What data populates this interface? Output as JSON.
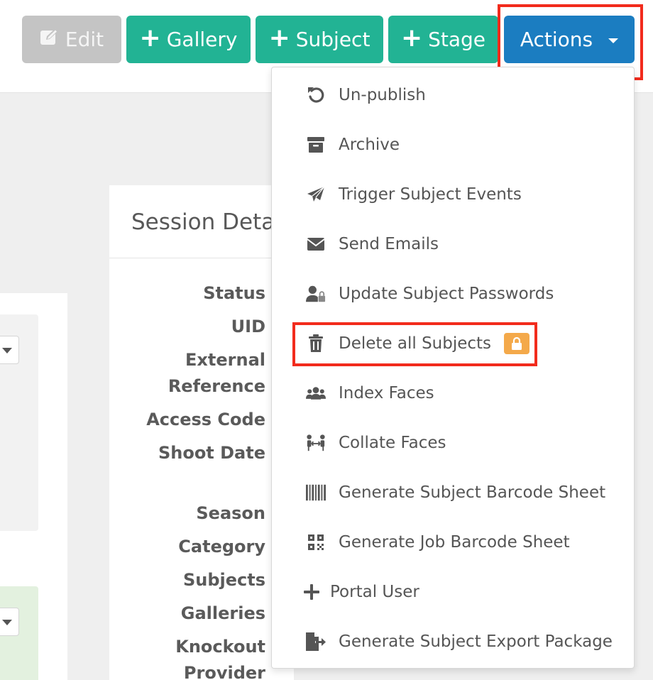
{
  "toolbar": {
    "edit_label": "Edit",
    "gallery_label": "Gallery",
    "subject_label": "Subject",
    "stage_label": "Stage",
    "actions_label": "Actions"
  },
  "panel": {
    "title": "Session Detai",
    "fields": {
      "status": "Status",
      "uid": "UID",
      "external_reference_line1": "External",
      "external_reference_line2": "Reference",
      "access_code": "Access Code",
      "shoot_date": "Shoot Date",
      "season": "Season",
      "category": "Category",
      "subjects": "Subjects",
      "galleries": "Galleries",
      "knockout_provider_line1": "Knockout",
      "knockout_provider_line2": "Provider"
    }
  },
  "actions_menu": {
    "items": [
      {
        "label": "Un-publish",
        "icon": "undo-icon"
      },
      {
        "label": "Archive",
        "icon": "archive-icon"
      },
      {
        "label": "Trigger Subject Events",
        "icon": "paper-plane-icon"
      },
      {
        "label": "Send Emails",
        "icon": "envelope-icon"
      },
      {
        "label": "Update Subject Passwords",
        "icon": "user-lock-icon"
      },
      {
        "label": "Delete all Subjects",
        "icon": "trash-icon",
        "locked": true
      },
      {
        "label": "Index Faces",
        "icon": "users-icon"
      },
      {
        "label": "Collate Faces",
        "icon": "people-arrows-icon"
      },
      {
        "label": "Generate Subject Barcode Sheet",
        "icon": "barcode-icon"
      },
      {
        "label": "Generate Job Barcode Sheet",
        "icon": "qrcode-icon"
      },
      {
        "label": "Portal User",
        "icon": "plus-icon"
      },
      {
        "label": "Generate Subject Export Package",
        "icon": "file-export-icon"
      }
    ]
  },
  "colors": {
    "green": "#22b394",
    "blue": "#1b7dc1",
    "disabled": "#c4c4c4",
    "highlight": "#f22b1c",
    "lock_badge": "#f4a94a"
  }
}
